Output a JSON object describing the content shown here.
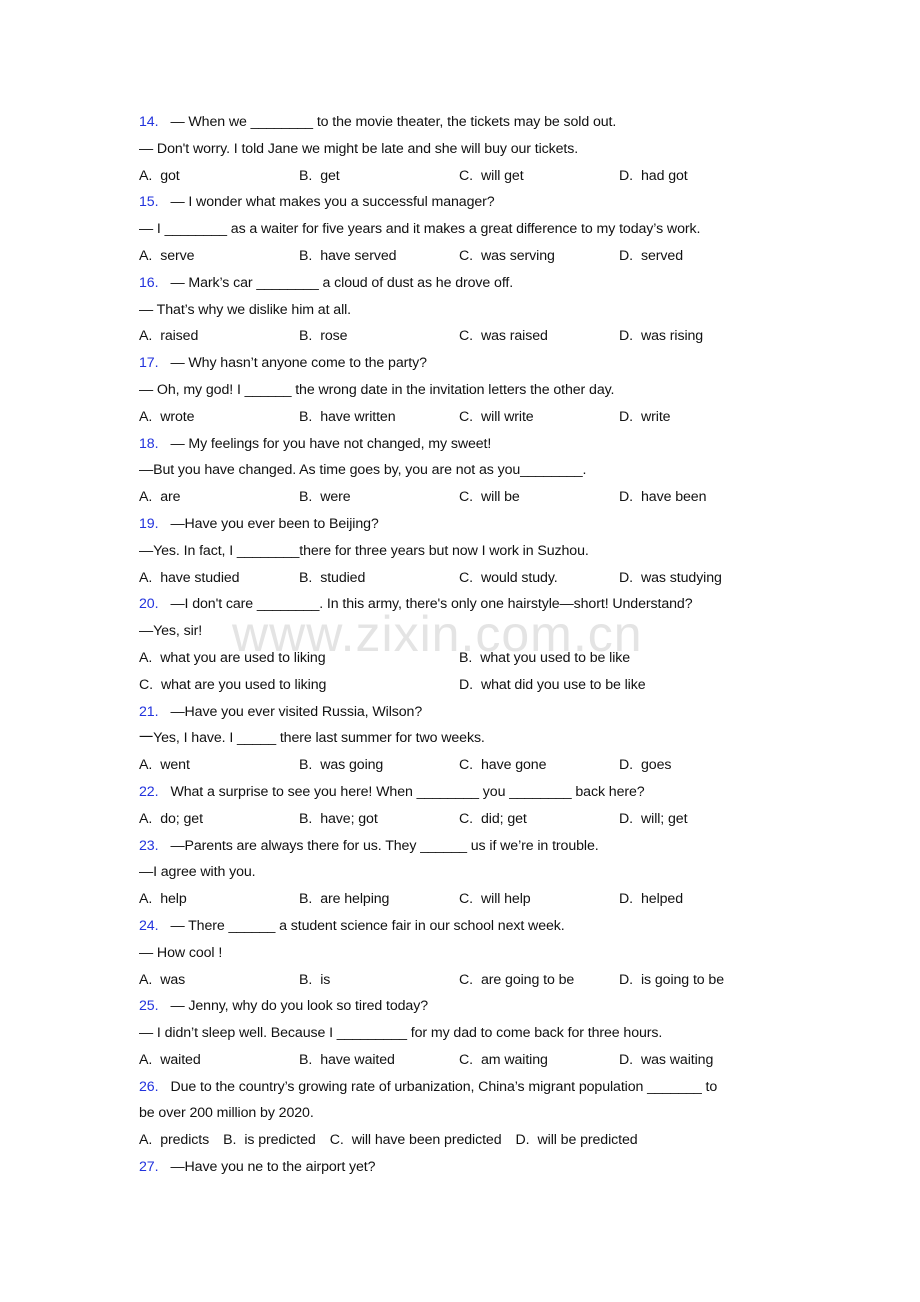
{
  "watermark": "www.zixin.com.cn",
  "accent_color": "#2233dd",
  "questions": [
    {
      "num": "14.",
      "lines": [
        "— When we ________ to the movie theater, the tickets may be sold out.",
        "— Don't worry. I told Jane we might be late and she will buy our tickets."
      ],
      "options": [
        {
          "letter": "A.",
          "text": "got"
        },
        {
          "letter": "B.",
          "text": "get"
        },
        {
          "letter": "C.",
          "text": "will get"
        },
        {
          "letter": "D.",
          "text": "had got"
        }
      ]
    },
    {
      "num": "15.",
      "lines": [
        "— I wonder what makes you a successful manager?",
        "— I ________ as a waiter for five years and it makes a great difference to my today’s work."
      ],
      "options": [
        {
          "letter": "A.",
          "text": "serve"
        },
        {
          "letter": "B.",
          "text": "have served"
        },
        {
          "letter": "C.",
          "text": "was serving"
        },
        {
          "letter": "D.",
          "text": "served"
        }
      ]
    },
    {
      "num": "16.",
      "lines": [
        "— Mark’s car ________ a cloud of dust as he drove off.",
        "— That’s why we dislike him at all."
      ],
      "options": [
        {
          "letter": "A.",
          "text": "raised"
        },
        {
          "letter": "B.",
          "text": "rose"
        },
        {
          "letter": "C.",
          "text": "was raised"
        },
        {
          "letter": "D.",
          "text": "was rising"
        }
      ]
    },
    {
      "num": "17.",
      "lines": [
        "— Why hasn’t anyone come to the party?",
        "— Oh, my god! I ______ the wrong date in the invitation letters the other day."
      ],
      "options": [
        {
          "letter": "A.",
          "text": "wrote"
        },
        {
          "letter": "B.",
          "text": "have written"
        },
        {
          "letter": "C.",
          "text": "will write"
        },
        {
          "letter": "D.",
          "text": "write"
        }
      ]
    },
    {
      "num": "18.",
      "lines": [
        "— My feelings for you have not changed, my sweet!",
        "—But you have changed. As time goes by, you are not as you________."
      ],
      "options": [
        {
          "letter": "A.",
          "text": "are"
        },
        {
          "letter": "B.",
          "text": "were"
        },
        {
          "letter": "C.",
          "text": "will be"
        },
        {
          "letter": "D.",
          "text": "have been"
        }
      ]
    },
    {
      "num": "19.",
      "lines": [
        "—Have you ever been to Beijing?",
        "—Yes. In fact, I ________there for three years but now I work in Suzhou."
      ],
      "options": [
        {
          "letter": "A.",
          "text": "have studied"
        },
        {
          "letter": "B.",
          "text": "studied"
        },
        {
          "letter": "C.",
          "text": "would study."
        },
        {
          "letter": "D.",
          "text": "was studying"
        }
      ]
    },
    {
      "num": "20.",
      "lines": [
        "—I don't care ________. In this army, there's only one hairstyle—short! Understand?",
        "—Yes, sir!"
      ],
      "options": [
        {
          "letter": "A.",
          "text": "what you are used to liking"
        },
        {
          "letter": "B.",
          "text": "what you used to be like"
        },
        {
          "letter": "C.",
          "text": "what are you used to liking"
        },
        {
          "letter": "D.",
          "text": "what did you use to be like"
        }
      ]
    },
    {
      "num": "21.",
      "lines": [
        "—Have you ever visited Russia, Wilson?",
        "一Yes, I have. I _____ there last summer for two weeks."
      ],
      "options": [
        {
          "letter": "A.",
          "text": "went"
        },
        {
          "letter": "B.",
          "text": "was going"
        },
        {
          "letter": "C.",
          "text": "have gone"
        },
        {
          "letter": "D.",
          "text": "goes"
        }
      ]
    },
    {
      "num": "22.",
      "lines": [
        "What a surprise to see you here! When ________ you ________ back here?"
      ],
      "options": [
        {
          "letter": "A.",
          "text": "do; get"
        },
        {
          "letter": "B.",
          "text": "have; got"
        },
        {
          "letter": "C.",
          "text": "did; get"
        },
        {
          "letter": "D.",
          "text": "will; get"
        }
      ]
    },
    {
      "num": "23.",
      "lines": [
        "—Parents are always there for us. They ______ us if we’re in trouble.",
        "—I agree with you."
      ],
      "options": [
        {
          "letter": "A.",
          "text": "help"
        },
        {
          "letter": "B.",
          "text": "are helping"
        },
        {
          "letter": "C.",
          "text": "will help"
        },
        {
          "letter": "D.",
          "text": "helped"
        }
      ]
    },
    {
      "num": "24.",
      "lines": [
        "— There ______ a student science fair in our school next week.",
        "— How cool !"
      ],
      "options": [
        {
          "letter": "A.",
          "text": "was"
        },
        {
          "letter": "B.",
          "text": "is"
        },
        {
          "letter": "C.",
          "text": "are going to be"
        },
        {
          "letter": "D.",
          "text": "is going to be"
        }
      ]
    },
    {
      "num": "25.",
      "lines": [
        "— Jenny, why do you look so tired today?",
        "— I didn’t sleep well. Because I _________ for my dad to come back for three hours."
      ],
      "options": [
        {
          "letter": "A.",
          "text": "waited"
        },
        {
          "letter": "B.",
          "text": "have waited"
        },
        {
          "letter": "C.",
          "text": "am waiting"
        },
        {
          "letter": "D.",
          "text": "was waiting"
        }
      ]
    },
    {
      "num": "26.",
      "lines": [
        "Due to the country’s growing rate of urbanization, China’s migrant population _______ to",
        "be over 200 million by 2020."
      ],
      "options": [
        {
          "letter": "A.",
          "text": "predicts"
        },
        {
          "letter": "B.",
          "text": "is predicted"
        },
        {
          "letter": "C.",
          "text": "will have been predicted"
        },
        {
          "letter": "D.",
          "text": "will be predicted"
        }
      ]
    },
    {
      "num": "27.",
      "lines": [
        "—Have you ne to the airport yet?"
      ],
      "options": []
    }
  ]
}
